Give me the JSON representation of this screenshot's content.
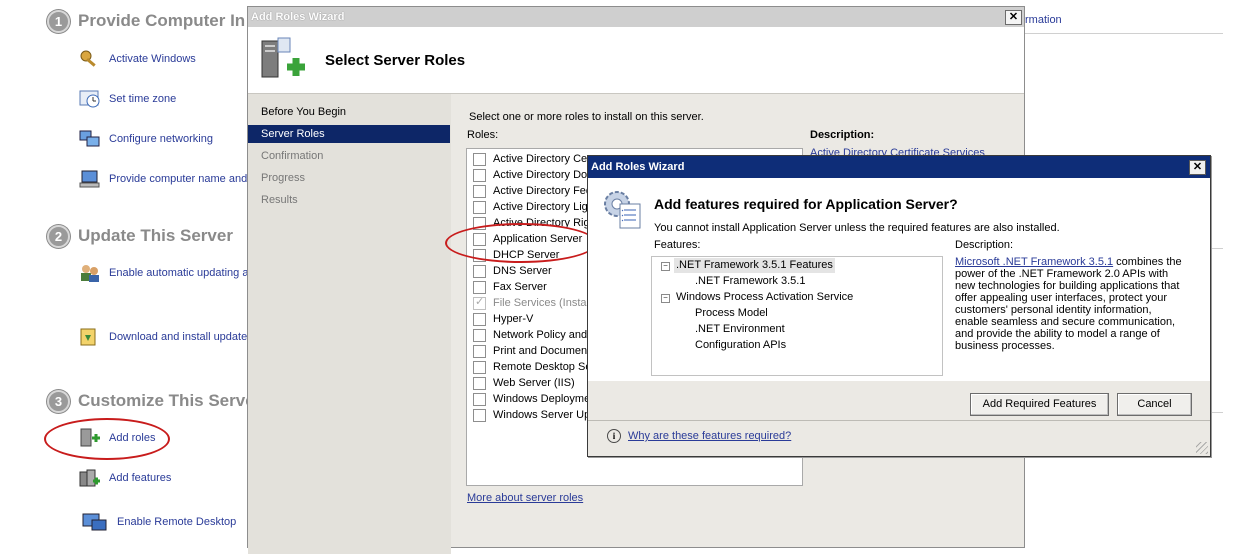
{
  "background": {
    "link_right": "rmation",
    "sections": [
      {
        "number": "1",
        "title": "Provide Computer In"
      },
      {
        "number": "2",
        "title": "Update This Server"
      },
      {
        "number": "3",
        "title": "Customize This Serve"
      }
    ],
    "tasks": [
      {
        "label": "Activate Windows",
        "icon": "key-icon"
      },
      {
        "label": "Set time zone",
        "icon": "clock-icon"
      },
      {
        "label": "Configure networking",
        "icon": "network-icon"
      },
      {
        "label": "Provide computer name and",
        "icon": "computer-icon"
      },
      {
        "label": "Enable automatic updating ar",
        "icon": "users-update-icon"
      },
      {
        "label": "Download and install updates",
        "icon": "download-icon"
      },
      {
        "label": "Add roles",
        "icon": "add-roles-icon"
      },
      {
        "label": "Add features",
        "icon": "add-features-icon"
      },
      {
        "label": "Enable Remote Desktop",
        "icon": "remote-desktop-icon"
      }
    ]
  },
  "wizard": {
    "window_title": "Add Roles Wizard",
    "header_title": "Select Server Roles",
    "nav": [
      {
        "label": "Before You Begin",
        "state": "normal"
      },
      {
        "label": "Server Roles",
        "state": "selected"
      },
      {
        "label": "Confirmation",
        "state": "dim"
      },
      {
        "label": "Progress",
        "state": "dim"
      },
      {
        "label": "Results",
        "state": "dim"
      }
    ],
    "intro": "Select one or more roles to install on this server.",
    "roles_label": "Roles:",
    "description_label": "Description:",
    "description_link": "Active Directory Certificate Services",
    "roles": [
      {
        "label": "Active Directory Cer",
        "checked": false,
        "disabled": false
      },
      {
        "label": "Active Directory Dor",
        "checked": false,
        "disabled": false
      },
      {
        "label": "Active Directory Fed",
        "checked": false,
        "disabled": false
      },
      {
        "label": "Active Directory Ligl",
        "checked": false,
        "disabled": false
      },
      {
        "label": "Active Directory Rig",
        "checked": false,
        "disabled": false
      },
      {
        "label": "Application Server",
        "checked": false,
        "disabled": false
      },
      {
        "label": "DHCP Server",
        "checked": false,
        "disabled": false
      },
      {
        "label": "DNS Server",
        "checked": false,
        "disabled": false
      },
      {
        "label": "Fax Server",
        "checked": false,
        "disabled": false
      },
      {
        "label": "File Services  (Insta",
        "checked": true,
        "disabled": true
      },
      {
        "label": "Hyper-V",
        "checked": false,
        "disabled": false
      },
      {
        "label": "Network Policy and",
        "checked": false,
        "disabled": false
      },
      {
        "label": "Print and Document",
        "checked": false,
        "disabled": false
      },
      {
        "label": "Remote Desktop Se",
        "checked": false,
        "disabled": false
      },
      {
        "label": "Web Server (IIS)",
        "checked": false,
        "disabled": false
      },
      {
        "label": "Windows Deploymen",
        "checked": false,
        "disabled": false
      },
      {
        "label": "Windows Server Up",
        "checked": false,
        "disabled": false
      }
    ],
    "more_link": "More about server roles"
  },
  "dialog": {
    "title": "Add Roles Wizard",
    "heading": "Add features required for Application Server?",
    "note": "You cannot install Application Server unless the required features are also installed.",
    "features_label": "Features:",
    "description_label": "Description:",
    "features": [
      {
        "label": ".NET Framework 3.5.1 Features",
        "level": 0,
        "expander": "−",
        "highlight": true
      },
      {
        "label": ".NET Framework 3.5.1",
        "level": 1,
        "expander": "",
        "highlight": false
      },
      {
        "label": "Windows Process Activation Service",
        "level": 0,
        "expander": "−",
        "highlight": false
      },
      {
        "label": "Process Model",
        "level": 1,
        "expander": "",
        "highlight": false
      },
      {
        "label": ".NET Environment",
        "level": 1,
        "expander": "",
        "highlight": false
      },
      {
        "label": "Configuration APIs",
        "level": 1,
        "expander": "",
        "highlight": false
      }
    ],
    "description_link_text": "Microsoft .NET Framework 3.5.1",
    "description_text": " combines the power of the .NET Framework 2.0 APIs with new technologies for building applications that offer appealing user interfaces, protect your customers' personal identity information, enable seamless and secure communication, and provide the ability to model a range of business processes.",
    "add_button": "Add Required Features",
    "cancel_button": "Cancel",
    "why_link": "Why are these features required?",
    "info_glyph": "i"
  },
  "colors": {
    "dialog_title_bar": "#0e2d78",
    "nav_selected": "#0d2667",
    "link": "#2a3b98",
    "annotation": "#c81c1c"
  }
}
